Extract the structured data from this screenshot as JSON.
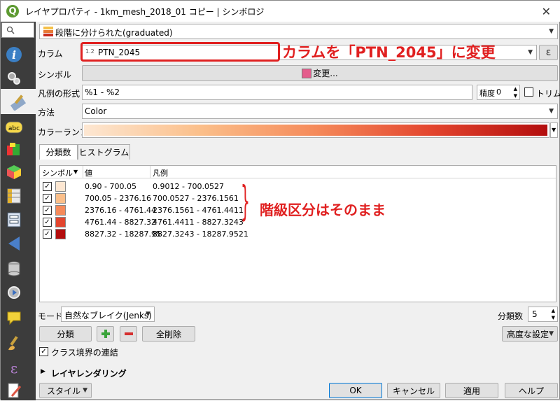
{
  "window": {
    "title": "レイヤプロパティ - 1km_mesh_2018_01 コピー | シンボロジ",
    "app_icon": "Q",
    "close": "✕"
  },
  "sidebar": {
    "search_glyph": "🔍"
  },
  "renderer": {
    "selected": "段階に分けられた(graduated)"
  },
  "form": {
    "column_label": "カラム",
    "column_type": "1.2",
    "column_value": "PTN_2045",
    "expression_btn": "ε",
    "symbol_label": "シンボル",
    "symbol_btn": "変更...",
    "legend_label": "凡例の形式",
    "legend_value": "%1 - %2",
    "precision_label": "精度",
    "precision_value": "0",
    "trim_label": "トリム",
    "method_label": "方法",
    "method_value": "Color",
    "ramp_label": "カラーランプ"
  },
  "annotations": {
    "column_note": "カラムを「PTN_2045」に変更",
    "class_note": "階級区分はそのまま"
  },
  "tabs": [
    {
      "label": "分類数"
    },
    {
      "label": "ヒストグラム"
    }
  ],
  "table": {
    "headers": [
      "シンボル",
      "値",
      "凡例"
    ],
    "rows": [
      {
        "value": "0.90 - 700.05",
        "legend": "0.9012 - 700.0527",
        "color": "#fde7d2"
      },
      {
        "value": "700.05 - 2376.16",
        "legend": "700.0527 - 2376.1561",
        "color": "#fbbf8a"
      },
      {
        "value": "2376.16 - 4761.44",
        "legend": "2376.1561 - 4761.4411",
        "color": "#f58a5a"
      },
      {
        "value": "4761.44 - 8827.32",
        "legend": "4761.4411 - 8827.3243",
        "color": "#e3452e"
      },
      {
        "value": "8827.32 - 18287.95",
        "legend": "8827.3243 - 18287.9521",
        "color": "#b30d0d"
      }
    ]
  },
  "bottom": {
    "mode_label": "モード",
    "mode_value": "自然なブレイク(Jenks)",
    "classes_label": "分類数",
    "classes_value": "5",
    "classify_btn": "分類",
    "delete_all_btn": "全削除",
    "advanced_btn": "高度な設定",
    "link_label": "クラス境界の連結",
    "layer_rendering": "レイヤレンダリング",
    "style_btn": "スタイル",
    "ok": "OK",
    "cancel": "キャンセル",
    "apply": "適用",
    "help": "ヘルプ"
  },
  "colors": {
    "accent_red": "#e02020",
    "ramp_start": "#fde7d2",
    "ramp_end": "#b30d0d"
  }
}
